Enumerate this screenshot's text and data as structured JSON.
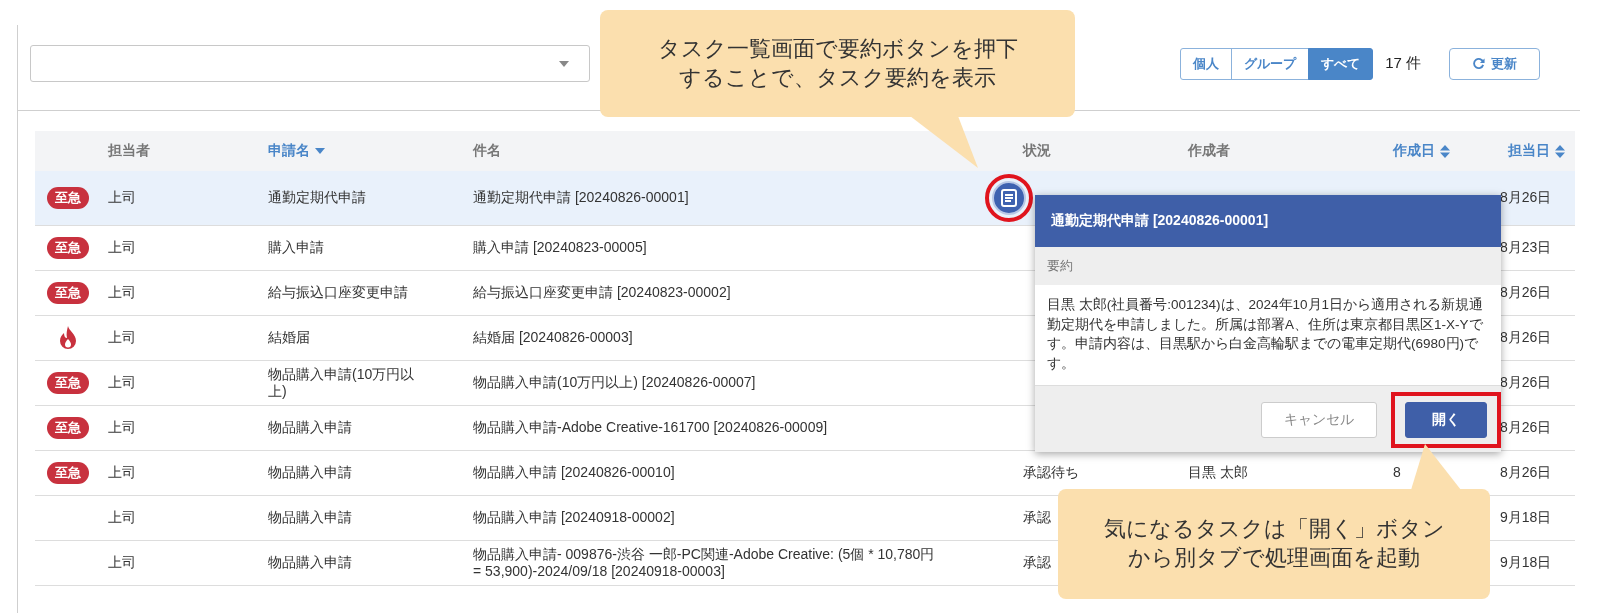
{
  "toolbar": {
    "scope_tabs": [
      {
        "label": "個人",
        "selected": false
      },
      {
        "label": "グループ",
        "selected": false
      },
      {
        "label": "すべて",
        "selected": true
      }
    ],
    "count": "17 件",
    "refresh_button": "更新"
  },
  "table": {
    "columns": [
      {},
      {
        "label": "担当者"
      },
      {
        "label": "申請名",
        "sort": {
          "kind": "descending"
        }
      },
      {
        "label": "件名"
      },
      {
        "label": "状況"
      },
      {
        "label": "作成者"
      },
      {
        "label": "作成日",
        "sort": {
          "kind": "both"
        }
      },
      {
        "label": "担当日",
        "sort": {
          "kind": "both"
        }
      }
    ],
    "rows": [
      {
        "priority": {
          "kind": "urgent",
          "label": "至急"
        },
        "assignee": "上司",
        "application": "通勤定期代申請",
        "subject": "通勤定期代申請 [20240826-00001]",
        "summary_button": {
          "highlighted": true
        },
        "assigned": "8月26日",
        "selected": true
      },
      {
        "priority": {
          "kind": "urgent",
          "label": "至急"
        },
        "assignee": "上司",
        "application": "購入申請",
        "subject": "購入申請 [20240823-00005]",
        "assigned": "8月23日",
        "selected": false
      },
      {
        "priority": {
          "kind": "urgent",
          "label": "至急"
        },
        "assignee": "上司",
        "application": "給与振込口座変更申請",
        "subject": "給与振込口座変更申請 [20240823-00002]",
        "assigned": "8月26日",
        "selected": false
      },
      {
        "priority": {
          "kind": "flame"
        },
        "assignee": "上司",
        "application": "結婚届",
        "subject": "結婚届 [20240826-00003]",
        "assigned": "8月26日",
        "selected": false
      },
      {
        "priority": {
          "kind": "urgent",
          "label": "至急"
        },
        "assignee": "上司",
        "application": "物品購入申請(10万円以上)",
        "subject": "物品購入申請(10万円以上) [20240826-00007]",
        "assigned": "8月26日",
        "selected": false
      },
      {
        "priority": {
          "kind": "urgent",
          "label": "至急"
        },
        "assignee": "上司",
        "application": "物品購入申請",
        "subject": "物品購入申請-Adobe Creative-161700 [20240826-00009]",
        "assigned": "8月26日",
        "selected": false
      },
      {
        "priority": {
          "kind": "urgent",
          "label": "至急"
        },
        "assignee": "上司",
        "application": "物品購入申請",
        "subject": "物品購入申請 [20240826-00010]",
        "status": "承認待ち",
        "creator": "目黒 太郎",
        "created": "8",
        "assigned": "8月26日",
        "selected": false
      },
      {
        "assignee": "上司",
        "application": "物品購入申請",
        "subject": "物品購入申請 [20240918-00002]",
        "status": "承認",
        "assigned": "9月18日",
        "selected": false
      },
      {
        "assignee": "上司",
        "application": "物品購入申請",
        "subject": "物品購入申請- 009876-渋谷 一郎-PC関連-Adobe Creative: (5個 * 10,780円 = 53,900)-2024/09/18 [20240918-00003]",
        "status": "承認",
        "assigned": "9月18日",
        "selected": false
      }
    ]
  },
  "summary_popup": {
    "title": "通勤定期代申請 [20240826-00001]",
    "section_label": "要約",
    "body": "目黒 太郎(社員番号:001234)は、2024年10月1日から適用される新規通勤定期代を申請しました。所属は部署A、住所は東京都目黒区1-X-Yです。申請内容は、目黒駅から白金高輪駅までの電車定期代(6980円)です。",
    "buttons": [
      {
        "label": "キャンセル",
        "kind": "secondary",
        "highlighted": false
      },
      {
        "label": "開く",
        "kind": "primary",
        "highlighted": true
      }
    ]
  },
  "callouts": [
    {
      "kind": "top",
      "text": "タスク一覧画面で要約ボタンを押下することで、タスク要約を表示"
    },
    {
      "kind": "bottom",
      "text": "気になるタスクは「開く」ボタンから別タブで処理画面を起動"
    }
  ]
}
